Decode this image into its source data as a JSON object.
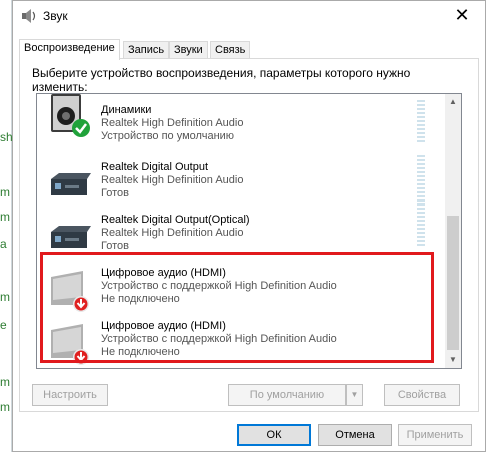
{
  "window": {
    "title": "Звук",
    "close_glyph": "✕"
  },
  "tabs": [
    "Воспроизведение",
    "Запись",
    "Звуки",
    "Связь"
  ],
  "instruction": "Выберите устройство воспроизведения, параметры которого нужно изменить:",
  "devices": [
    {
      "name": "Динамики",
      "driver": "Realtek High Definition Audio",
      "status": "Устройство по умолчанию",
      "icon": "speaker-default-icon"
    },
    {
      "name": "Realtek Digital Output",
      "driver": "Realtek High Definition Audio",
      "status": "Готов",
      "icon": "digital-output-icon"
    },
    {
      "name": "Realtek Digital Output(Optical)",
      "driver": "Realtek High Definition Audio",
      "status": "Готов",
      "icon": "optical-output-icon"
    },
    {
      "name": "Цифровое аудио (HDMI)",
      "driver": "Устройство с поддержкой High Definition Audio",
      "status": "Не подключено",
      "icon": "hdmi-disconnected-icon"
    },
    {
      "name": "Цифровое аудио (HDMI)",
      "driver": "Устройство с поддержкой High Definition Audio",
      "status": "Не подключено",
      "icon": "hdmi-disconnected-icon"
    }
  ],
  "buttons": {
    "configure": "Настроить",
    "set_default": "По умолчанию",
    "properties": "Свойства",
    "ok": "ОК",
    "cancel": "Отмена",
    "apply": "Применить"
  },
  "background_glyphs": [
    "sh",
    "m",
    "m",
    "a",
    "m",
    "e",
    "m",
    "m"
  ],
  "colors": {
    "highlight": "#e1191d",
    "accent": "#0078d7"
  }
}
